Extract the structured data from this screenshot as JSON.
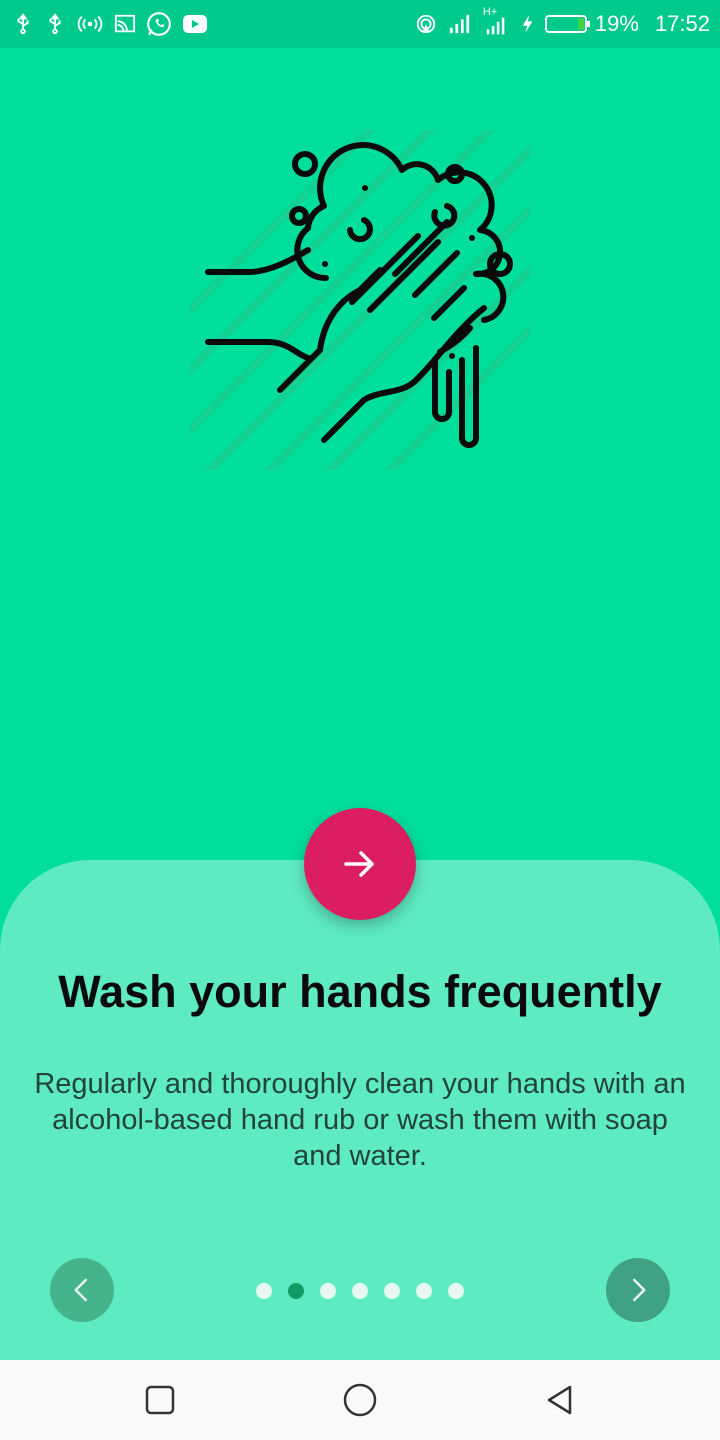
{
  "status_bar": {
    "battery_percent": "19%",
    "time": "17:52",
    "network_label": "H+",
    "left_icons": [
      "usb-icon",
      "usb-icon",
      "hotspot-icon",
      "cast-icon",
      "whatsapp-icon",
      "youtube-icon"
    ],
    "right_icons": [
      "wifi-hotspot-icon",
      "signal-icon",
      "signal-icon",
      "charging-icon",
      "battery-icon"
    ]
  },
  "onboarding": {
    "illustration": "hand-washing-icon",
    "title": "Wash your hands frequently",
    "description": "Regularly and thoroughly clean your hands with an alcohol-based hand rub or wash them with soap and water.",
    "page_count": 7,
    "active_page": 2
  },
  "colors": {
    "background": "#00DE9C",
    "status_bar": "#00C98C",
    "sheet": "#5EEBC2",
    "accent": "#DB1E5F",
    "active_dot": "#139A62"
  },
  "nav_bar": {
    "icons": [
      "recents-icon",
      "home-icon",
      "back-icon"
    ]
  }
}
